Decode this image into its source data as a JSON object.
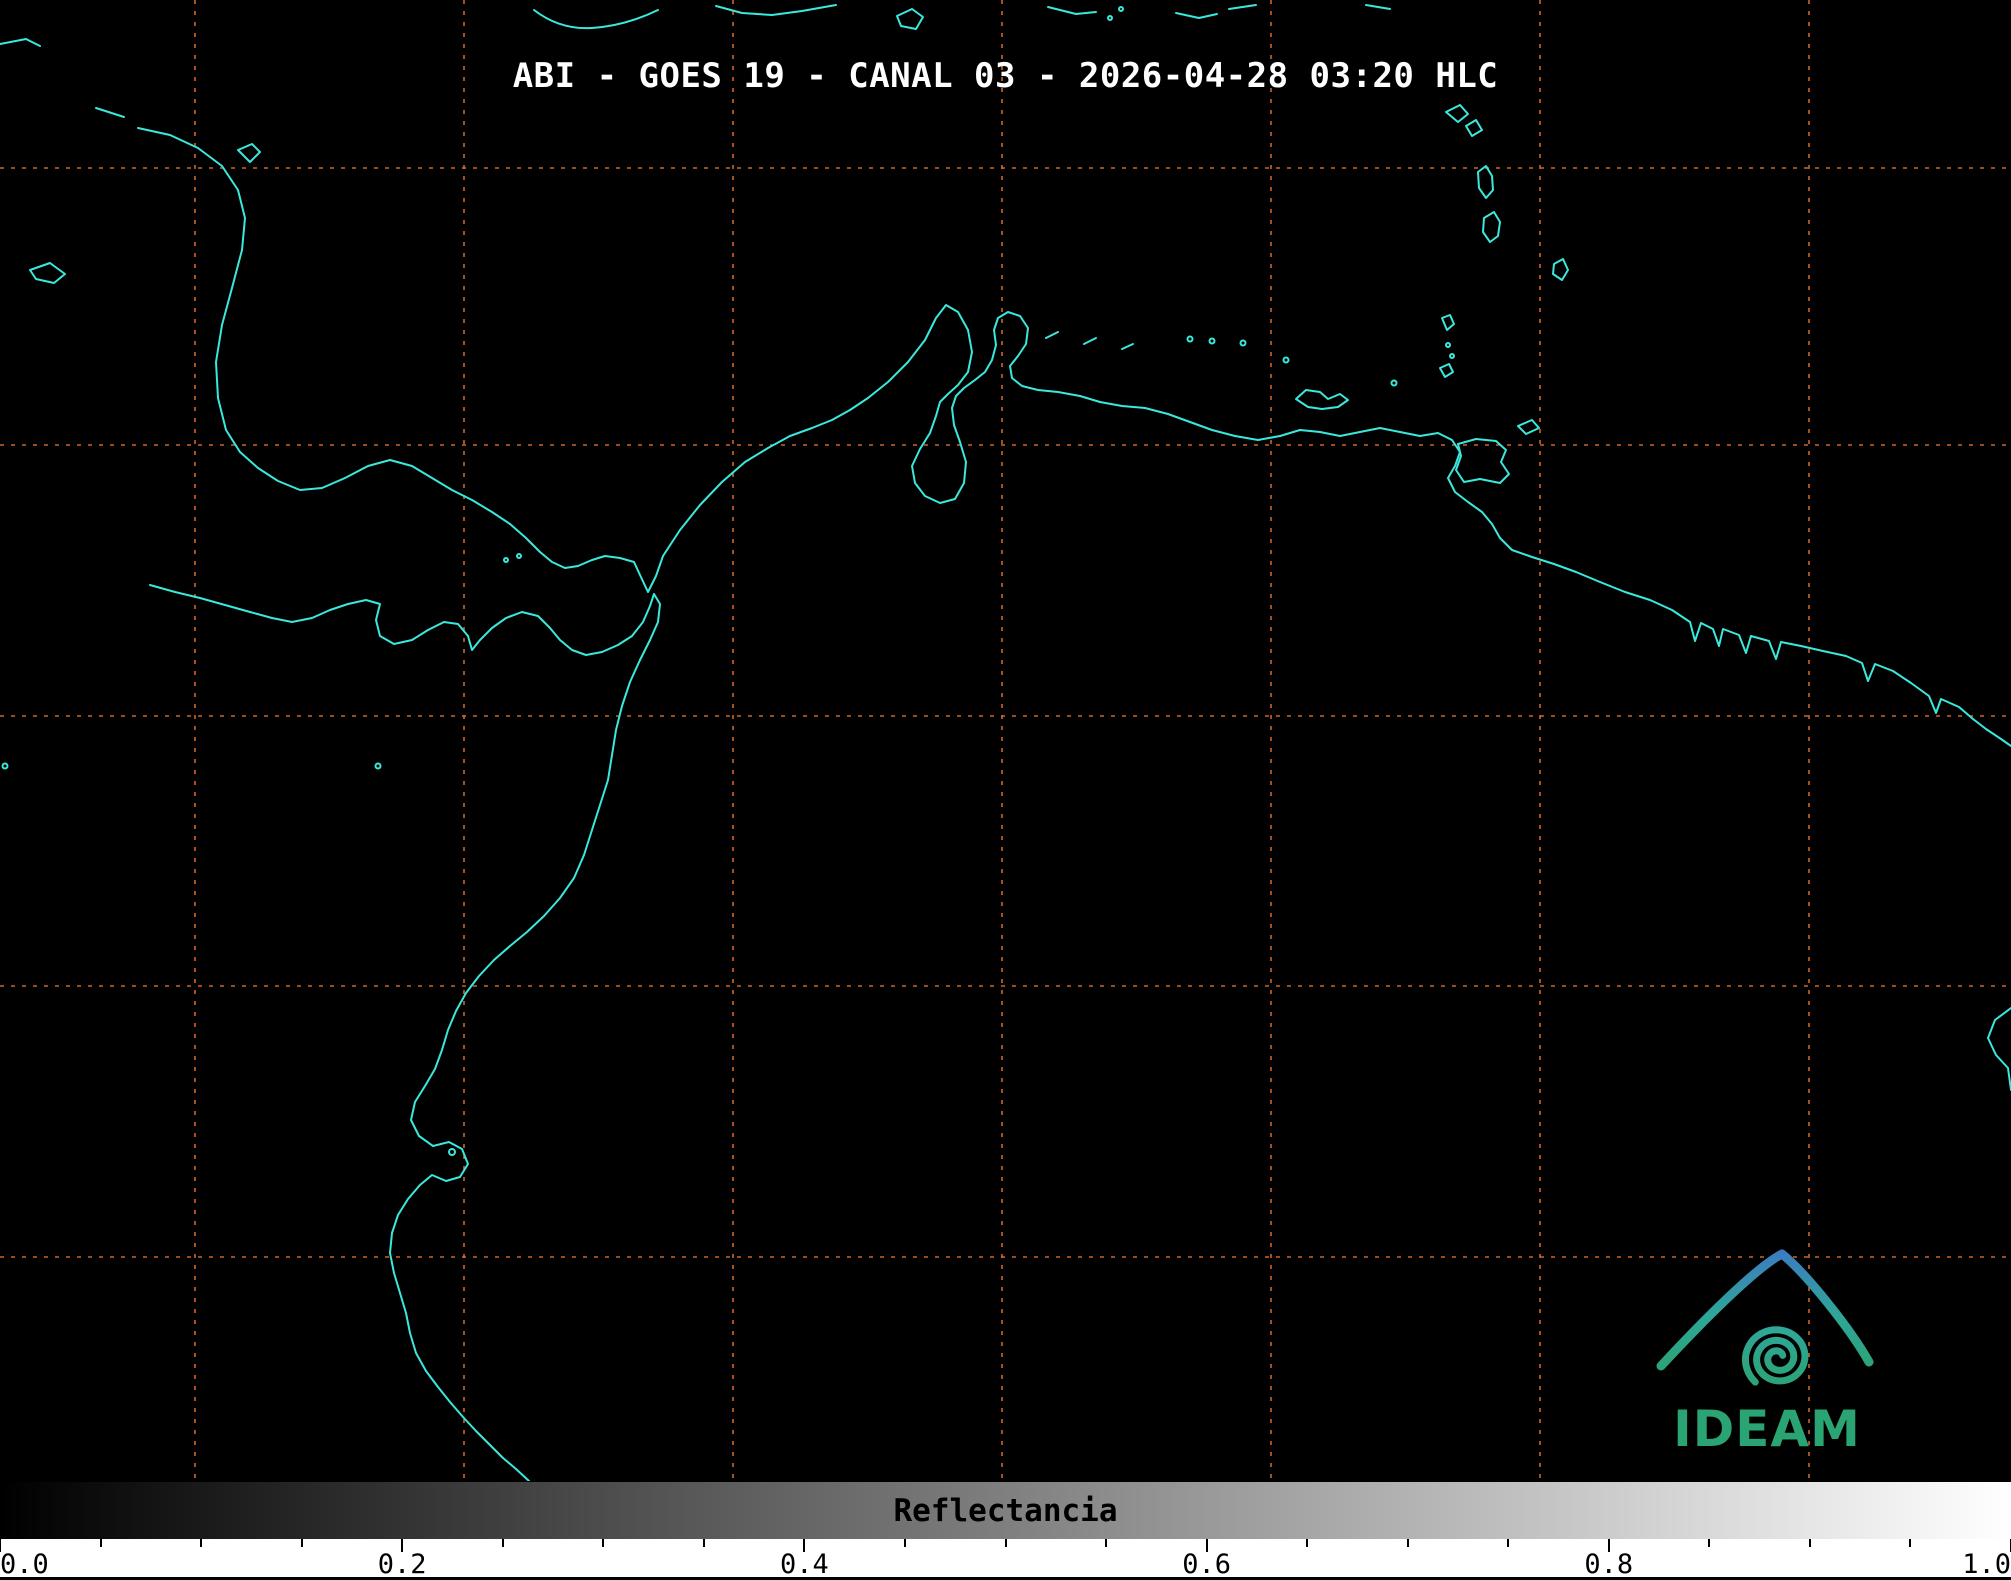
{
  "map": {
    "title": "ABI - GOES 19 - CANAL 03 - 2026-04-28 03:20 HLC",
    "background_color": "#000000",
    "coastline_color": "#3ae8dc",
    "grid_color": "#d96c2a"
  },
  "colorbar": {
    "label": "Reflectancia",
    "tick_labels": [
      "0.0",
      "0.2",
      "0.4",
      "0.6",
      "0.8",
      "1.0"
    ],
    "gradient_start_color": "#000000",
    "gradient_end_color": "#ffffff"
  },
  "logo": {
    "text": "IDEAM",
    "color_top": "#3c7dbf",
    "color_mid": "#2fa698",
    "color_bottom": "#2ca377",
    "text_color": "#2aa473"
  }
}
